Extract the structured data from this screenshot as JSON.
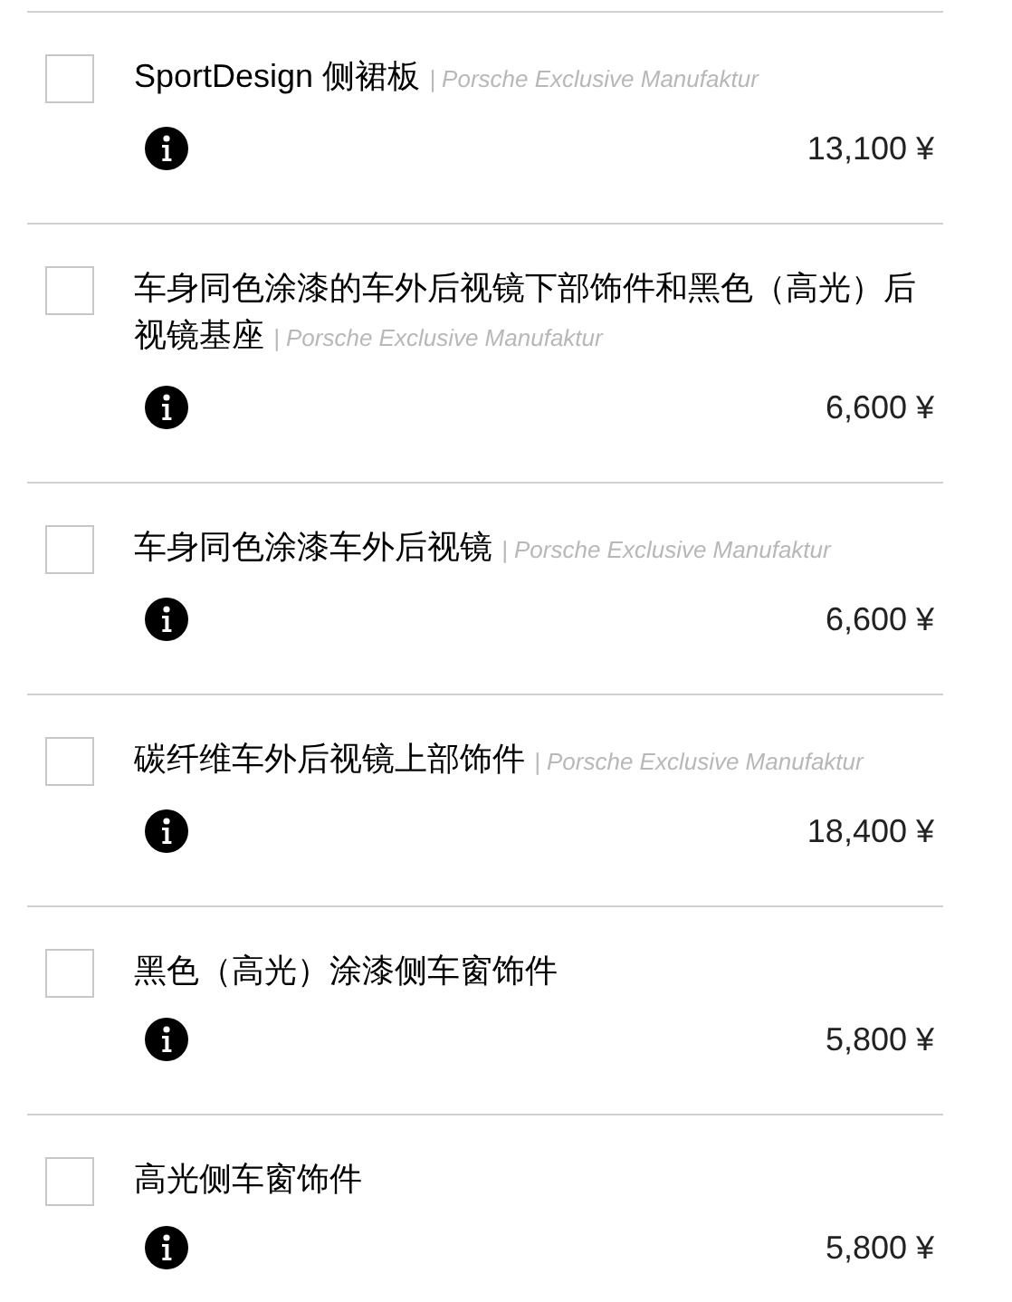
{
  "options": [
    {
      "title": "SportDesign 侧裙板",
      "source": "| Porsche Exclusive Manufaktur",
      "price": "13,100 ¥",
      "checked": false
    },
    {
      "title": "车身同色涂漆的车外后视镜下部饰件和黑色（高光）后视镜基座",
      "source": "| Porsche Exclusive Manufaktur",
      "price": "6,600 ¥",
      "checked": false
    },
    {
      "title": "车身同色涂漆车外后视镜",
      "source": "| Porsche Exclusive Manufaktur",
      "price": "6,600 ¥",
      "checked": false
    },
    {
      "title": "碳纤维车外后视镜上部饰件",
      "source": "| Porsche Exclusive Manufaktur",
      "price": "18,400 ¥",
      "checked": false
    },
    {
      "title": "黑色（高光）涂漆侧车窗饰件",
      "price": "5,800 ¥",
      "checked": false
    },
    {
      "title": "高光侧车窗饰件",
      "price": "5,800 ¥",
      "checked": false
    }
  ]
}
